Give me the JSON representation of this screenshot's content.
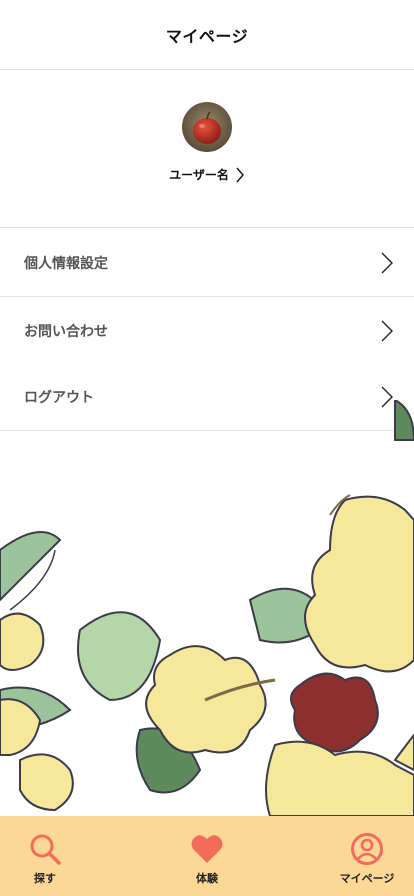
{
  "header": {
    "title": "マイページ"
  },
  "profile": {
    "username": "ユーザー名",
    "avatar_icon": "apple-avatar"
  },
  "menu": [
    {
      "label": "個人情報設定",
      "icon": "chevron-right-icon"
    },
    {
      "label": "お問い合わせ",
      "icon": "chevron-right-icon"
    },
    {
      "label": "ログアウト",
      "icon": "chevron-right-icon"
    }
  ],
  "tabs": [
    {
      "label": "探す",
      "icon": "search-icon"
    },
    {
      "label": "体験",
      "icon": "heart-icon"
    },
    {
      "label": "マイページ",
      "icon": "user-circle-icon"
    }
  ],
  "colors": {
    "accent": "#f26b5b",
    "tabbar": "#fcd896",
    "flower_yellow": "#f7e79a",
    "flower_red": "#8c2f2f",
    "leaf_green": "#9cc49a"
  }
}
